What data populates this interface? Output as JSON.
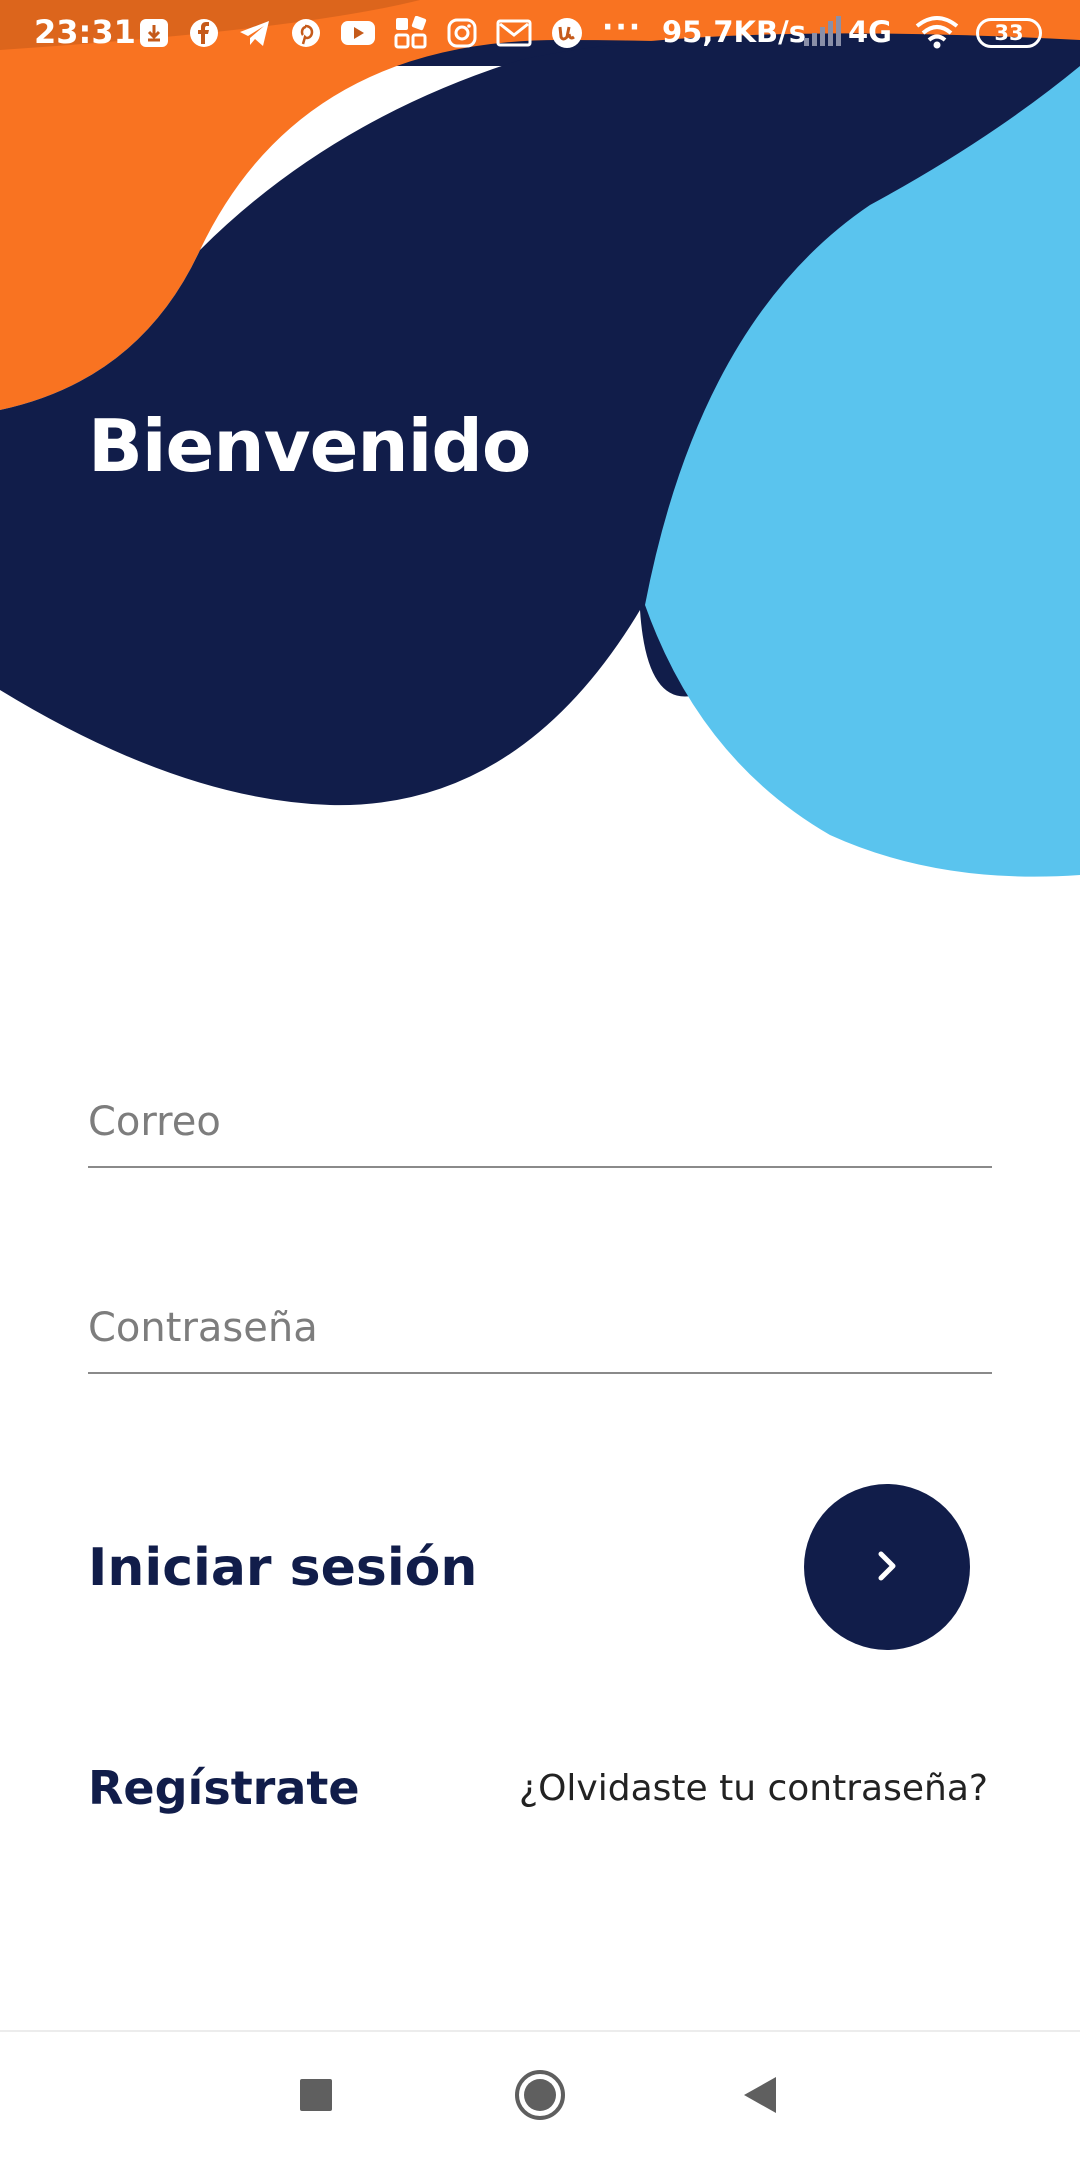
{
  "status_bar": {
    "time": "23:31",
    "overflow": "···",
    "network_speed": "95,7KB/s",
    "network_type": "4G",
    "battery": "33",
    "icons": [
      "download-icon",
      "facebook-icon",
      "telegram-icon",
      "pinterest-icon",
      "youtube-icon",
      "apps-icon",
      "instagram-icon",
      "gmail-icon",
      "app-u-icon",
      "signal-icon",
      "wifi-icon",
      "battery-icon"
    ]
  },
  "header": {
    "title": "Bienvenido"
  },
  "form": {
    "email_placeholder": "Correo",
    "password_placeholder": "Contraseña"
  },
  "actions": {
    "login_label": "Iniciar sesión",
    "login_button_icon": "chevron-right-icon",
    "register_label": "Regístrate",
    "forgot_password_label": "¿Olvidaste tu contraseña?"
  },
  "navigation": {
    "recents_icon": "square-icon",
    "home_icon": "circle-icon",
    "back_icon": "triangle-back-icon"
  },
  "colors": {
    "navy": "#111d4a",
    "orange": "#f97321",
    "light_blue": "#5ac4ee",
    "status_orange": "#c55a1a"
  }
}
